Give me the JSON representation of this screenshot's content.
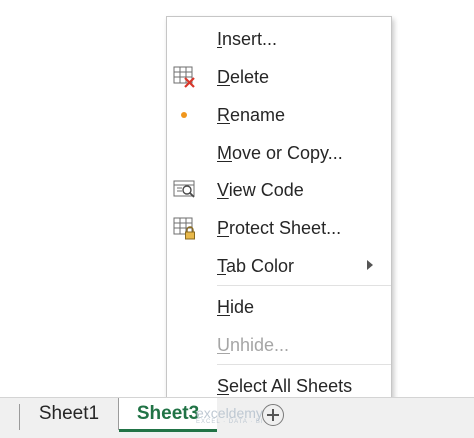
{
  "context_menu": {
    "items": [
      {
        "pre": "",
        "key": "I",
        "post": "nsert...",
        "icon": "",
        "enabled": true
      },
      {
        "pre": "",
        "key": "D",
        "post": "elete",
        "icon": "delete-sheet-icon",
        "enabled": true
      },
      {
        "pre": "",
        "key": "R",
        "post": "ename",
        "icon": "rename-dot-icon",
        "enabled": true
      },
      {
        "pre": "",
        "key": "M",
        "post": "ove or Copy...",
        "icon": "",
        "enabled": true
      },
      {
        "pre": "",
        "key": "V",
        "post": "iew Code",
        "icon": "view-code-icon",
        "enabled": true
      },
      {
        "pre": "",
        "key": "P",
        "post": "rotect Sheet...",
        "icon": "protect-sheet-icon",
        "enabled": true
      },
      {
        "pre": "",
        "key": "T",
        "post": "ab Color",
        "icon": "",
        "enabled": true,
        "submenu": true
      },
      {
        "pre": "",
        "key": "H",
        "post": "ide",
        "icon": "",
        "enabled": true
      },
      {
        "pre": "",
        "key": "U",
        "post": "nhide...",
        "icon": "",
        "enabled": false
      },
      {
        "pre": "",
        "key": "S",
        "post": "elect All Sheets",
        "icon": "",
        "enabled": true
      }
    ]
  },
  "sheet_tabs": {
    "tabs": [
      "Sheet1",
      "Sheet3"
    ],
    "active": "Sheet3"
  },
  "watermark": {
    "text": "exceldemy",
    "sub": "EXCEL · DATA · BI"
  },
  "colors": {
    "accent": "#217346",
    "rename_dot": "#f0961c",
    "disabled_text": "#a6a6a6"
  }
}
